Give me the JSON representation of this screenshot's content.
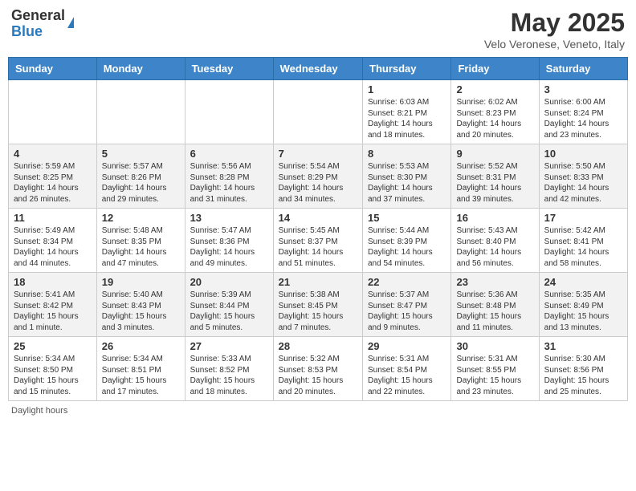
{
  "header": {
    "logo_general": "General",
    "logo_blue": "Blue",
    "month_title": "May 2025",
    "location": "Velo Veronese, Veneto, Italy"
  },
  "days_of_week": [
    "Sunday",
    "Monday",
    "Tuesday",
    "Wednesday",
    "Thursday",
    "Friday",
    "Saturday"
  ],
  "weeks": [
    [
      {
        "day": "",
        "info": ""
      },
      {
        "day": "",
        "info": ""
      },
      {
        "day": "",
        "info": ""
      },
      {
        "day": "",
        "info": ""
      },
      {
        "day": "1",
        "info": "Sunrise: 6:03 AM\nSunset: 8:21 PM\nDaylight: 14 hours\nand 18 minutes."
      },
      {
        "day": "2",
        "info": "Sunrise: 6:02 AM\nSunset: 8:23 PM\nDaylight: 14 hours\nand 20 minutes."
      },
      {
        "day": "3",
        "info": "Sunrise: 6:00 AM\nSunset: 8:24 PM\nDaylight: 14 hours\nand 23 minutes."
      }
    ],
    [
      {
        "day": "4",
        "info": "Sunrise: 5:59 AM\nSunset: 8:25 PM\nDaylight: 14 hours\nand 26 minutes."
      },
      {
        "day": "5",
        "info": "Sunrise: 5:57 AM\nSunset: 8:26 PM\nDaylight: 14 hours\nand 29 minutes."
      },
      {
        "day": "6",
        "info": "Sunrise: 5:56 AM\nSunset: 8:28 PM\nDaylight: 14 hours\nand 31 minutes."
      },
      {
        "day": "7",
        "info": "Sunrise: 5:54 AM\nSunset: 8:29 PM\nDaylight: 14 hours\nand 34 minutes."
      },
      {
        "day": "8",
        "info": "Sunrise: 5:53 AM\nSunset: 8:30 PM\nDaylight: 14 hours\nand 37 minutes."
      },
      {
        "day": "9",
        "info": "Sunrise: 5:52 AM\nSunset: 8:31 PM\nDaylight: 14 hours\nand 39 minutes."
      },
      {
        "day": "10",
        "info": "Sunrise: 5:50 AM\nSunset: 8:33 PM\nDaylight: 14 hours\nand 42 minutes."
      }
    ],
    [
      {
        "day": "11",
        "info": "Sunrise: 5:49 AM\nSunset: 8:34 PM\nDaylight: 14 hours\nand 44 minutes."
      },
      {
        "day": "12",
        "info": "Sunrise: 5:48 AM\nSunset: 8:35 PM\nDaylight: 14 hours\nand 47 minutes."
      },
      {
        "day": "13",
        "info": "Sunrise: 5:47 AM\nSunset: 8:36 PM\nDaylight: 14 hours\nand 49 minutes."
      },
      {
        "day": "14",
        "info": "Sunrise: 5:45 AM\nSunset: 8:37 PM\nDaylight: 14 hours\nand 51 minutes."
      },
      {
        "day": "15",
        "info": "Sunrise: 5:44 AM\nSunset: 8:39 PM\nDaylight: 14 hours\nand 54 minutes."
      },
      {
        "day": "16",
        "info": "Sunrise: 5:43 AM\nSunset: 8:40 PM\nDaylight: 14 hours\nand 56 minutes."
      },
      {
        "day": "17",
        "info": "Sunrise: 5:42 AM\nSunset: 8:41 PM\nDaylight: 14 hours\nand 58 minutes."
      }
    ],
    [
      {
        "day": "18",
        "info": "Sunrise: 5:41 AM\nSunset: 8:42 PM\nDaylight: 15 hours\nand 1 minute."
      },
      {
        "day": "19",
        "info": "Sunrise: 5:40 AM\nSunset: 8:43 PM\nDaylight: 15 hours\nand 3 minutes."
      },
      {
        "day": "20",
        "info": "Sunrise: 5:39 AM\nSunset: 8:44 PM\nDaylight: 15 hours\nand 5 minutes."
      },
      {
        "day": "21",
        "info": "Sunrise: 5:38 AM\nSunset: 8:45 PM\nDaylight: 15 hours\nand 7 minutes."
      },
      {
        "day": "22",
        "info": "Sunrise: 5:37 AM\nSunset: 8:47 PM\nDaylight: 15 hours\nand 9 minutes."
      },
      {
        "day": "23",
        "info": "Sunrise: 5:36 AM\nSunset: 8:48 PM\nDaylight: 15 hours\nand 11 minutes."
      },
      {
        "day": "24",
        "info": "Sunrise: 5:35 AM\nSunset: 8:49 PM\nDaylight: 15 hours\nand 13 minutes."
      }
    ],
    [
      {
        "day": "25",
        "info": "Sunrise: 5:34 AM\nSunset: 8:50 PM\nDaylight: 15 hours\nand 15 minutes."
      },
      {
        "day": "26",
        "info": "Sunrise: 5:34 AM\nSunset: 8:51 PM\nDaylight: 15 hours\nand 17 minutes."
      },
      {
        "day": "27",
        "info": "Sunrise: 5:33 AM\nSunset: 8:52 PM\nDaylight: 15 hours\nand 18 minutes."
      },
      {
        "day": "28",
        "info": "Sunrise: 5:32 AM\nSunset: 8:53 PM\nDaylight: 15 hours\nand 20 minutes."
      },
      {
        "day": "29",
        "info": "Sunrise: 5:31 AM\nSunset: 8:54 PM\nDaylight: 15 hours\nand 22 minutes."
      },
      {
        "day": "30",
        "info": "Sunrise: 5:31 AM\nSunset: 8:55 PM\nDaylight: 15 hours\nand 23 minutes."
      },
      {
        "day": "31",
        "info": "Sunrise: 5:30 AM\nSunset: 8:56 PM\nDaylight: 15 hours\nand 25 minutes."
      }
    ]
  ],
  "footer": {
    "daylight_label": "Daylight hours"
  }
}
